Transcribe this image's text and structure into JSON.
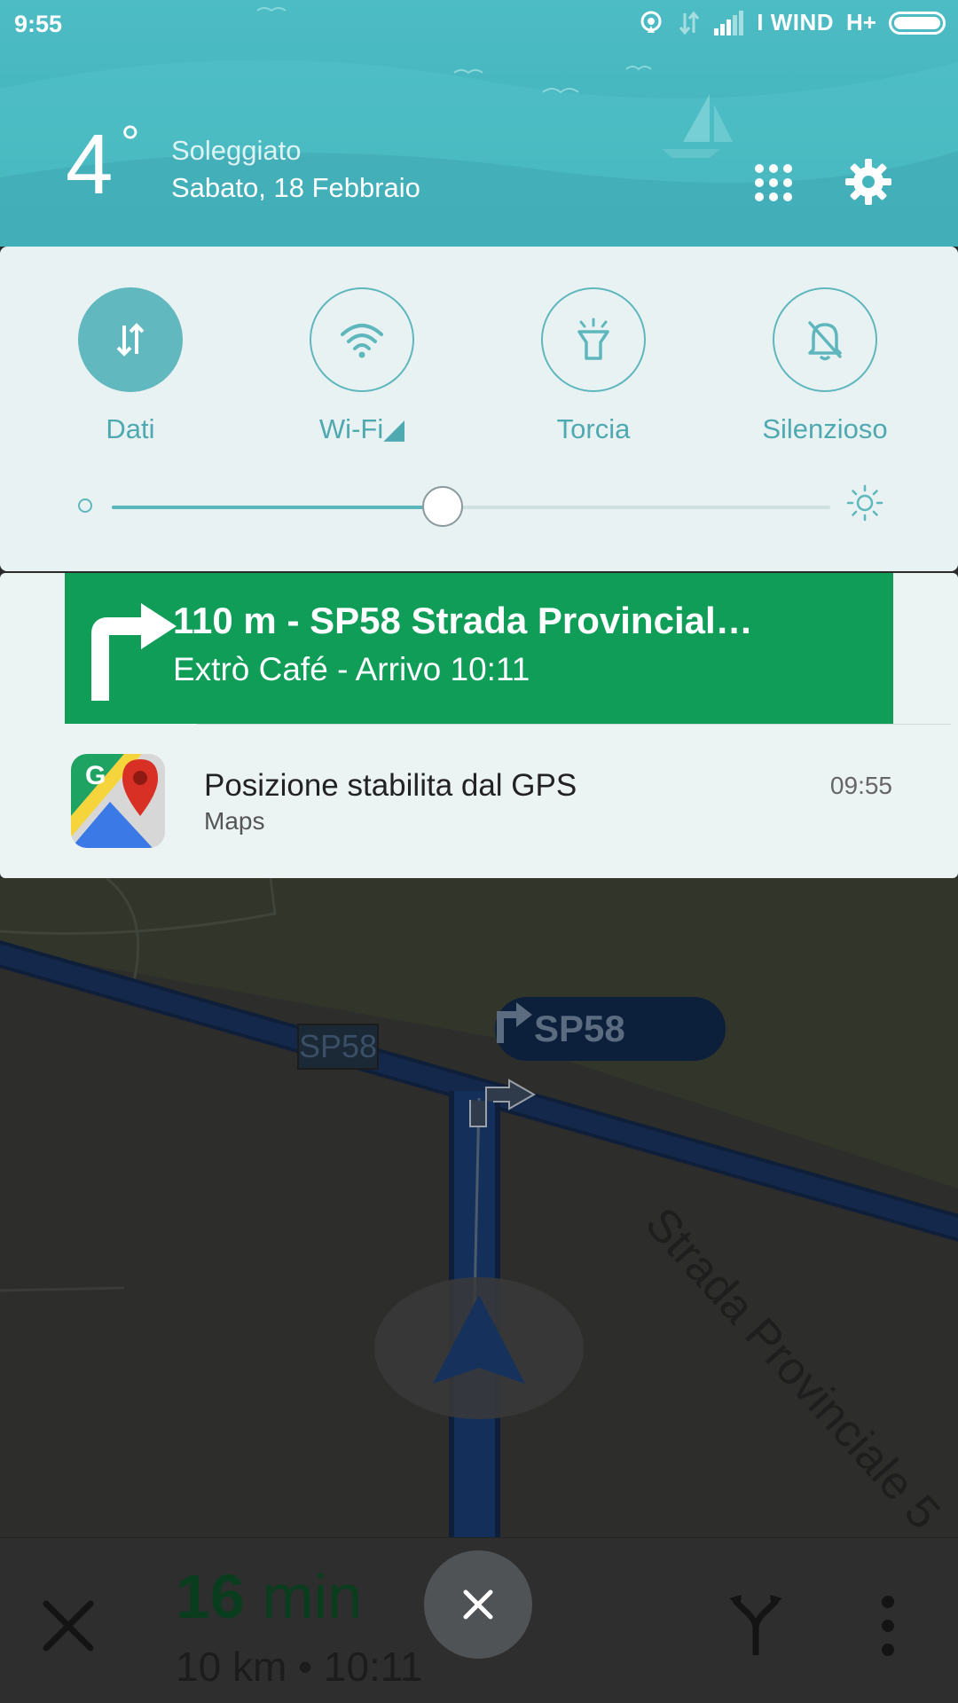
{
  "status_bar": {
    "time": "9:55",
    "carrier": "I WIND",
    "network": "H+"
  },
  "weather": {
    "temperature": "4",
    "degree_symbol": "°",
    "condition": "Soleggiato",
    "date": "Sabato, 18 Febbraio"
  },
  "quick_settings": {
    "toggles": [
      {
        "label": "Dati",
        "active": true,
        "icon": "data-arrows-icon"
      },
      {
        "label": "Wi-Fi◢",
        "active": false,
        "icon": "wifi-icon"
      },
      {
        "label": "Torcia",
        "active": false,
        "icon": "flashlight-icon"
      },
      {
        "label": "Silenzioso",
        "active": false,
        "icon": "bell-off-icon"
      }
    ],
    "brightness_level": 0.46
  },
  "navigation_notification": {
    "title": "110 m - SP58 Strada Provincial…",
    "subtitle": "Extrò Café - Arrivo 10:11",
    "icon": "turn-right-icon"
  },
  "gps_notification": {
    "title": "Posizione stabilita dal GPS",
    "app": "Maps",
    "time": "09:55",
    "icon": "google-maps-icon"
  },
  "map": {
    "road_label": "SP58",
    "turn_instruction": "SP58",
    "street_name": "Strada Provinciale 5"
  },
  "bottom_bar": {
    "eta_minutes": "16",
    "eta_unit": "min",
    "distance_time": "10 km  •  10:11"
  },
  "colors": {
    "header_teal": "#45b5bd",
    "accent_teal": "#5fb7be",
    "nav_green": "#0f9d58"
  }
}
